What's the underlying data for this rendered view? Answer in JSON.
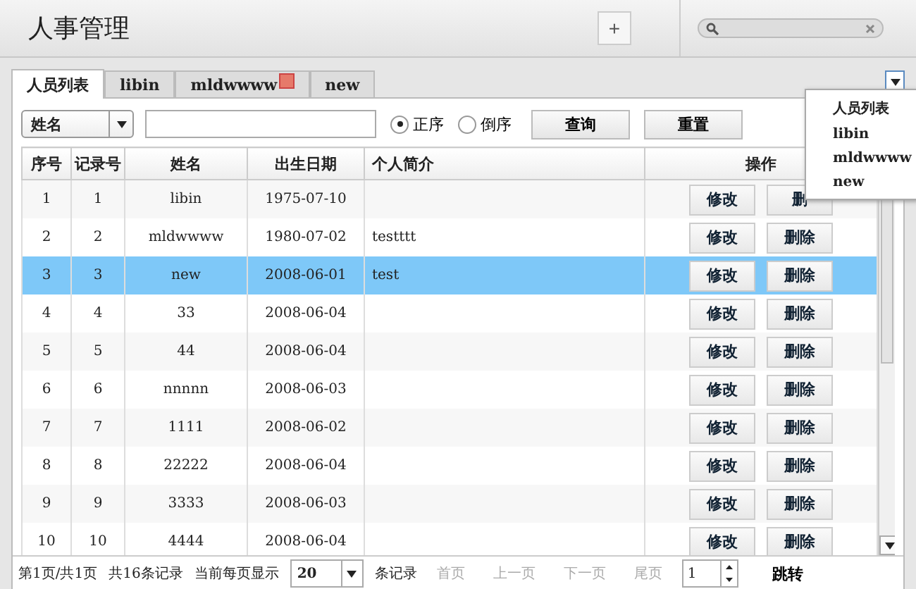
{
  "header": {
    "title": "人事管理",
    "add_button": "+"
  },
  "tabs": [
    {
      "label": "人员列表",
      "selected": true,
      "closable": false
    },
    {
      "label": "libin",
      "selected": false,
      "closable": false
    },
    {
      "label": "mldwwww",
      "selected": false,
      "closable": true
    },
    {
      "label": "new",
      "selected": false,
      "closable": false
    }
  ],
  "tab_menu": {
    "items": [
      "人员列表",
      "libin",
      "mldwwww",
      "new"
    ]
  },
  "toolbar": {
    "field_select": "姓名",
    "radios": [
      {
        "label": "正序",
        "selected": true
      },
      {
        "label": "倒序",
        "selected": false
      }
    ],
    "buttons": [
      "查询",
      "重置"
    ]
  },
  "table": {
    "columns": [
      "序号",
      "记录号",
      "姓名",
      "出生日期",
      "个人简介",
      "操作"
    ],
    "rows": [
      {
        "cells": [
          "1",
          "1",
          "libin",
          "1975-07-10",
          ""
        ],
        "selected": false,
        "actions": [
          "修改",
          "删"
        ]
      },
      {
        "cells": [
          "2",
          "2",
          "mldwwww",
          "1980-07-02",
          "testttt"
        ],
        "selected": false,
        "actions": [
          "修改",
          "删除"
        ]
      },
      {
        "cells": [
          "3",
          "3",
          "new",
          "2008-06-01",
          "test"
        ],
        "selected": true,
        "actions": [
          "修改",
          "删除"
        ]
      },
      {
        "cells": [
          "4",
          "4",
          "33",
          "2008-06-04",
          ""
        ],
        "selected": false,
        "actions": [
          "修改",
          "删除"
        ]
      },
      {
        "cells": [
          "5",
          "5",
          "44",
          "2008-06-04",
          ""
        ],
        "selected": false,
        "actions": [
          "修改",
          "删除"
        ]
      },
      {
        "cells": [
          "6",
          "6",
          "nnnnn",
          "2008-06-03",
          ""
        ],
        "selected": false,
        "actions": [
          "修改",
          "删除"
        ]
      },
      {
        "cells": [
          "7",
          "7",
          "1111",
          "2008-06-02",
          ""
        ],
        "selected": false,
        "actions": [
          "修改",
          "删除"
        ]
      },
      {
        "cells": [
          "8",
          "8",
          "22222",
          "2008-06-04",
          ""
        ],
        "selected": false,
        "actions": [
          "修改",
          "删除"
        ]
      },
      {
        "cells": [
          "9",
          "9",
          "3333",
          "2008-06-03",
          ""
        ],
        "selected": false,
        "actions": [
          "修改",
          "删除"
        ]
      },
      {
        "cells": [
          "10",
          "10",
          "4444",
          "2008-06-04",
          ""
        ],
        "selected": false,
        "actions": [
          "修改",
          "删除"
        ]
      }
    ]
  },
  "pager": {
    "page_info": "第1页/共1页",
    "total": "共16条记录",
    "page_size_label": "当前每页显示",
    "page_size": "20",
    "unit": "条记录",
    "links": [
      {
        "label": "首页",
        "disabled": true
      },
      {
        "label": "上一页",
        "disabled": true
      },
      {
        "label": "下一页",
        "disabled": true
      },
      {
        "label": "尾页",
        "disabled": true
      }
    ],
    "page_input": "1",
    "go_button": "跳转"
  }
}
